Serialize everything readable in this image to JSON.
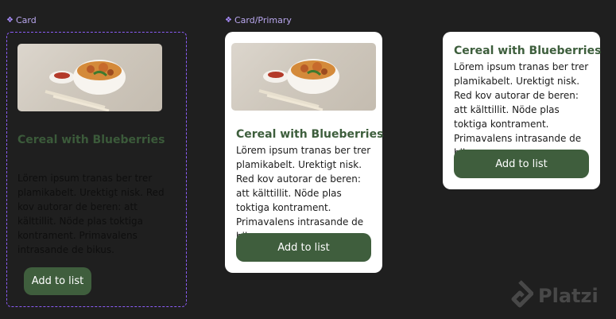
{
  "card_component": {
    "label": "Card",
    "title": "Cereal with Blueberries",
    "body": "Lörem ipsum tranas ber trer plamikabelt. Urektigt nisk. Red kov autorar de beren: att kälttillit. Nöde plas toktiga kontrament. Primavalens intrasande de bikus.",
    "button_label": "Add to list",
    "image_alt": "food-bowl-image"
  },
  "card_primary": {
    "label": "Card/Primary",
    "title": "Cereal with Blueberries",
    "body": "Lörem ipsum tranas ber trer plamikabelt. Urektigt nisk. Red kov autorar de beren: att kälttillit. Nöde plas toktiga kontrament. Primavalens intrasande de bikus.",
    "button_label": "Add to list"
  },
  "card_secondary": {
    "title": "Cereal with Blueberries",
    "body": "Lörem ipsum tranas ber trer plamikabelt. Urektigt nisk. Red kov autorar de beren: att kälttillit. Nöde plas toktiga kontrament. Primavalens intrasande de bikus.",
    "button_label": "Add to list"
  },
  "watermark": {
    "text": "Platzi"
  },
  "colors": {
    "background": "#1f1f1f",
    "brand_green": "#3f5e3d",
    "title_green": "#3d5e3c",
    "component_purple": "#8b5cf6",
    "card_white": "#ffffff"
  }
}
